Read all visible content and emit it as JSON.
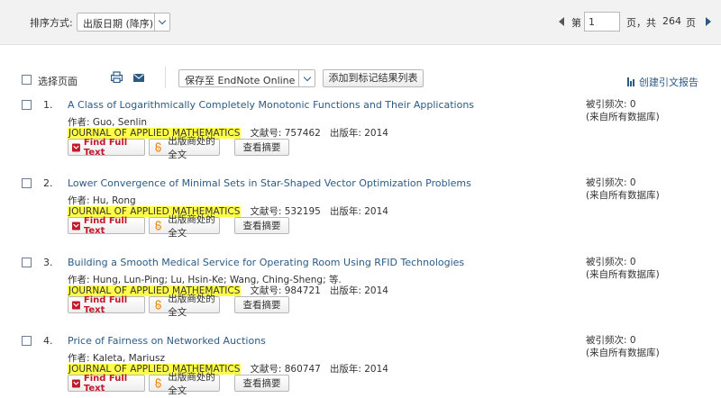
{
  "sort": {
    "label": "排序方式:",
    "selected": "出版日期 (降序)"
  },
  "pager": {
    "prefix": "第",
    "current_page": "1",
    "suffix": "页，共",
    "total": "264",
    "suffix2": "页"
  },
  "toolbar": {
    "select_page": "选择页面",
    "save_to": "保存至 EndNote Online",
    "add_marked": "添加到标记结果列表",
    "create_report": "创建引文报告"
  },
  "buttons": {
    "find_full_text": "Find Full Text",
    "publisher_full_text": "出版商处的全文",
    "view_abstract": "查看摘要"
  },
  "records": [
    {
      "num": "1.",
      "title": "A Class of Logarithmically Completely Monotonic Functions and Their Applications",
      "authors": "作者: Guo, Senlin",
      "journal": "JOURNAL OF APPLIED MATHEMATICS",
      "article_no": "文献号: 757462",
      "year": "出版年: 2014",
      "cites": "被引频次: 0",
      "cites_note": "(来自所有数据库)"
    },
    {
      "num": "2.",
      "title": "Lower Convergence of Minimal Sets in Star-Shaped Vector Optimization Problems",
      "authors": "作者: Hu, Rong",
      "journal": "JOURNAL OF APPLIED MATHEMATICS",
      "article_no": "文献号: 532195",
      "year": "出版年: 2014",
      "cites": "被引频次: 0",
      "cites_note": "(来自所有数据库)"
    },
    {
      "num": "3.",
      "title": "Building a Smooth Medical Service for Operating Room Using RFID Technologies",
      "authors": "作者: Hung, Lun-Ping; Lu, Hsin-Ke; Wang, Ching-Sheng; 等.",
      "journal": "JOURNAL OF APPLIED MATHEMATICS",
      "article_no": "文献号: 984721",
      "year": "出版年: 2014",
      "cites": "被引频次: 0",
      "cites_note": "(来自所有数据库)"
    },
    {
      "num": "4.",
      "title": "Price of Fairness on Networked Auctions",
      "authors": "作者: Kaleta, Mariusz",
      "journal": "JOURNAL OF APPLIED MATHEMATICS",
      "article_no": "文献号: 860747",
      "year": "出版年: 2014",
      "cites": "被引频次: 0",
      "cites_note": "(来自所有数据库)"
    }
  ],
  "colors": {
    "link": "#2c5a86",
    "highlight": "#ffff4a",
    "fft_red": "#c0192a",
    "lock_orange": "#e8820c"
  }
}
